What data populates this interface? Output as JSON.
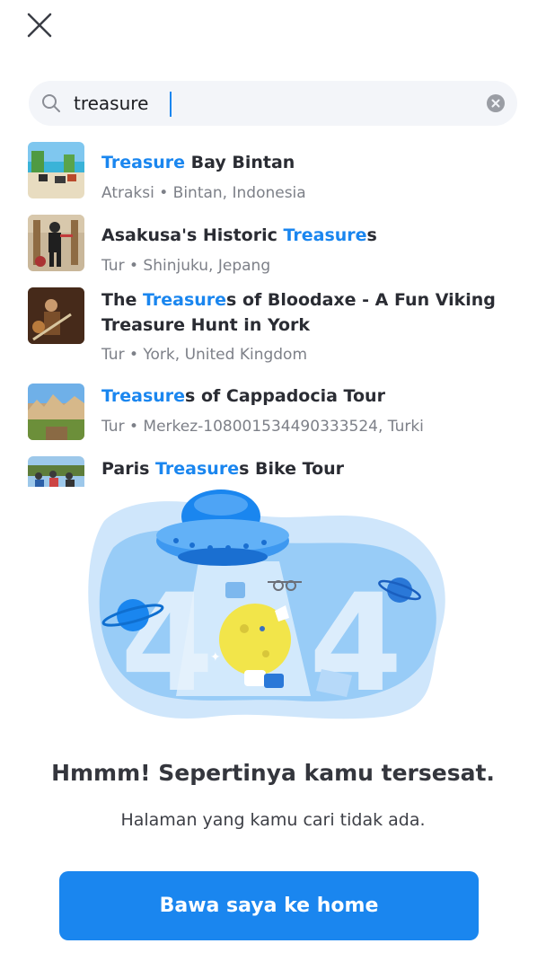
{
  "search": {
    "value": "treasure",
    "placeholder": ""
  },
  "results": [
    {
      "title_parts": [
        {
          "text": "Treasure",
          "highlight": true
        },
        {
          "text": " Bay Bintan",
          "highlight": false
        }
      ],
      "subtitle": "Atraksi • Bintan, Indonesia",
      "thumb": "beach"
    },
    {
      "title_parts": [
        {
          "text": "Asakusa's Historic ",
          "highlight": false
        },
        {
          "text": "Treasure",
          "highlight": true
        },
        {
          "text": "s",
          "highlight": false
        }
      ],
      "subtitle": "Tur • Shinjuku, Jepang",
      "thumb": "ninja"
    },
    {
      "title_parts": [
        {
          "text": "The ",
          "highlight": false
        },
        {
          "text": "Treasure",
          "highlight": true
        },
        {
          "text": "s of Bloodaxe - A Fun Viking Treasure Hunt in York",
          "highlight": false
        }
      ],
      "subtitle": "Tur • York, United Kingdom",
      "thumb": "viking"
    },
    {
      "title_parts": [
        {
          "text": "Treasure",
          "highlight": true
        },
        {
          "text": "s of Cappadocia Tour",
          "highlight": false
        }
      ],
      "subtitle": "Tur • Merkez-108001534490333524, Turki",
      "thumb": "cappadocia"
    },
    {
      "title_parts": [
        {
          "text": "Paris ",
          "highlight": false
        },
        {
          "text": "Treasure",
          "highlight": true
        },
        {
          "text": "s Bike Tour",
          "highlight": false
        }
      ],
      "subtitle": "",
      "thumb": "paris"
    }
  ],
  "error": {
    "code_left": "4",
    "code_right": "4",
    "title": "Hmmm! Sepertinya kamu tersesat.",
    "subtitle": "Halaman yang kamu cari tidak ada.",
    "button_label": "Bawa saya ke home"
  },
  "icons": {
    "close": "close-icon",
    "search": "search-icon",
    "clear": "clear-icon"
  },
  "colors": {
    "accent": "#1a86ef",
    "title_text": "#2a2c33",
    "secondary_text": "#7d8088",
    "search_bg": "#f3f5f9"
  }
}
